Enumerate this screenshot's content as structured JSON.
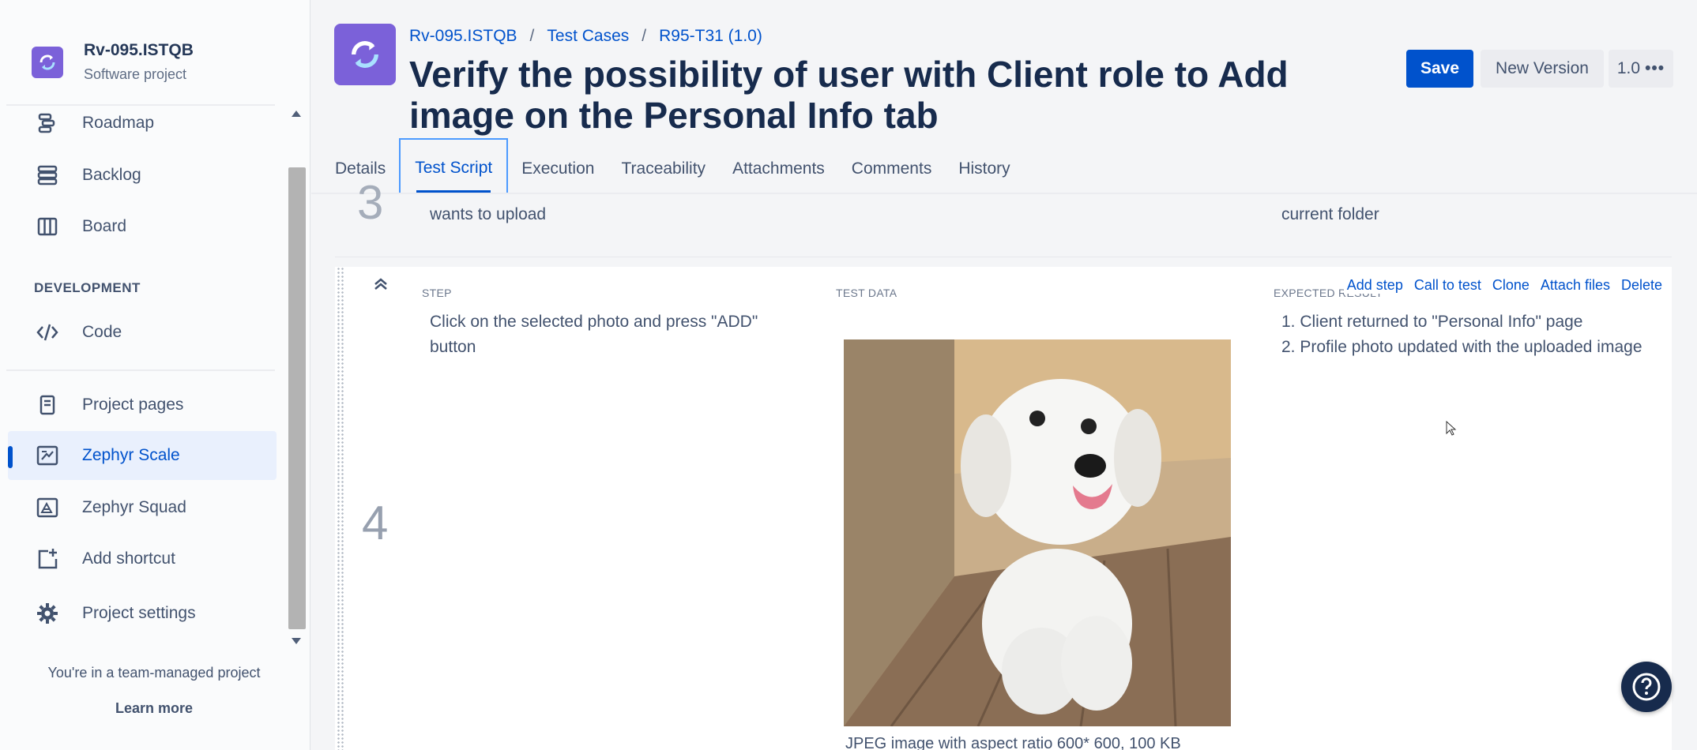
{
  "project": {
    "name": "Rv-095.ISTQB",
    "type": "Software project",
    "icon": "project-sync-icon"
  },
  "sidebar": {
    "items_top": [
      {
        "label": "Roadmap",
        "icon": "roadmap-icon"
      },
      {
        "label": "Backlog",
        "icon": "backlog-icon"
      },
      {
        "label": "Board",
        "icon": "board-icon"
      }
    ],
    "section_development": "DEVELOPMENT",
    "items_dev": [
      {
        "label": "Code",
        "icon": "code-icon"
      }
    ],
    "items_bottom": [
      {
        "label": "Project pages",
        "icon": "page-icon"
      },
      {
        "label": "Zephyr Scale",
        "icon": "zephyr-scale-icon",
        "active": true
      },
      {
        "label": "Zephyr Squad",
        "icon": "zephyr-squad-icon"
      },
      {
        "label": "Add shortcut",
        "icon": "add-shortcut-icon"
      },
      {
        "label": "Project settings",
        "icon": "gear-icon"
      }
    ],
    "team_note": "You're in a team-managed project",
    "learn_more": "Learn more"
  },
  "header": {
    "breadcrumb": [
      "Rv-095.ISTQB",
      "Test Cases",
      "R95-T31 (1.0)"
    ],
    "breadcrumb_sep": "/",
    "title": "Verify the possibility of user with Client role to Add image on the Personal Info tab",
    "save_label": "Save",
    "new_version_label": "New Version",
    "version_label": "1.0"
  },
  "tabs": [
    "Details",
    "Test Script",
    "Execution",
    "Traceability",
    "Attachments",
    "Comments",
    "History"
  ],
  "active_tab": "Test Script",
  "steps": {
    "prev": {
      "number": "3",
      "step": "wants to upload",
      "expected": "current folder"
    },
    "current": {
      "number": "4",
      "col_step": "STEP",
      "col_data": "TEST DATA",
      "col_expected": "EXPECTED RESULT",
      "step": "Click on the selected photo and press \"ADD\" button",
      "expected_1": "1. Client returned to \"Personal Info\" page",
      "expected_2": "2. Profile photo updated with the uploaded image",
      "data_caption": "JPEG image with aspect ratio 600* 600, 100 KB",
      "actions": [
        "Add step",
        "Call to test",
        "Clone",
        "Attach files",
        "Delete"
      ]
    }
  },
  "colors": {
    "accent": "#0052CC",
    "avatar": "#7B61D9"
  }
}
